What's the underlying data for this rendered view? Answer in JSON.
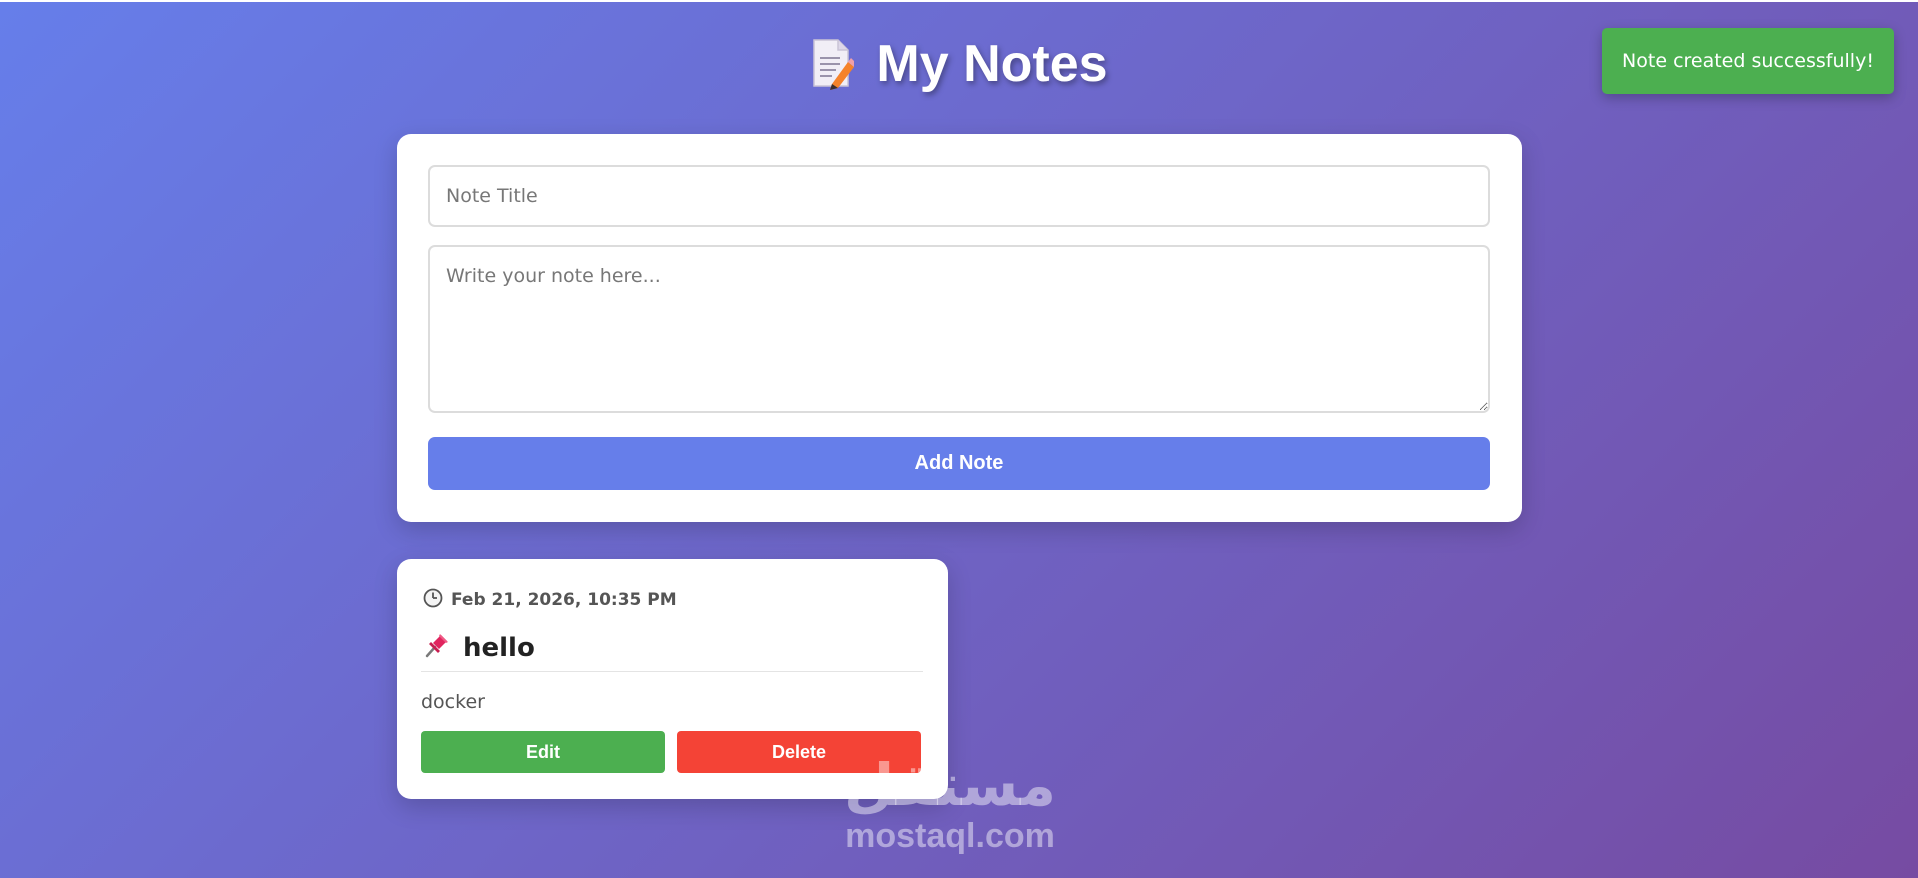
{
  "header": {
    "icon": "memo-icon",
    "title": "My Notes"
  },
  "toast": {
    "message": "Note created successfully!",
    "color": "#4caf50"
  },
  "form": {
    "title_placeholder": "Note Title",
    "content_placeholder": "Write your note here...",
    "add_label": "Add Note",
    "accent": "#667eea"
  },
  "notes": [
    {
      "date_icon": "clock-icon",
      "date": "Feb 21, 2026, 10:35 PM",
      "title_icon": "pushpin-icon",
      "title": "hello",
      "content": "docker",
      "edit_label": "Edit",
      "delete_label": "Delete"
    }
  ],
  "watermark": {
    "logo_arabic": "مستقل",
    "logo_text": "mostaql.com"
  },
  "colors": {
    "gradient_start": "#667eea",
    "gradient_end": "#764ba2",
    "edit": "#4caf50",
    "delete": "#f44336"
  }
}
